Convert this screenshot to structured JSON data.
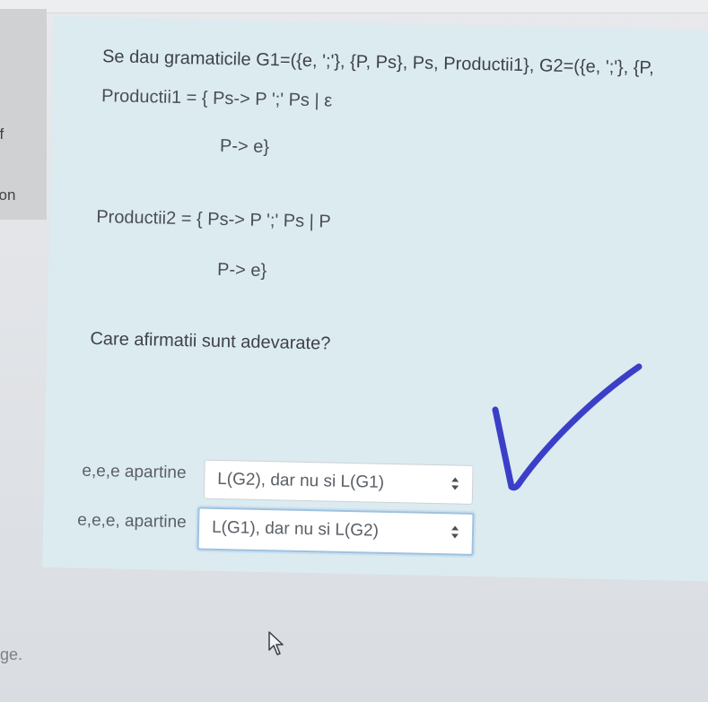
{
  "nav": {
    "items": [
      {
        "label": "of"
      },
      {
        "label": "tion"
      }
    ],
    "bottom_label": "ge."
  },
  "question": {
    "intro": "Se dau gramaticile G1=({e, ';'}, {P, Ps}, Ps, Productii1}, G2=({e, ';'}, {P,",
    "productii1_line1": "Productii1 = { Ps-> P ';' Ps | ε",
    "productii1_line2": "P-> e}",
    "productii2_line1": "Productii2 = { Ps-> P ';' Ps | P",
    "productii2_line2": "P-> e}",
    "prompt": "Care afirmatii sunt adevarate?"
  },
  "answers": [
    {
      "label": "e,e,e apartine",
      "selected": "L(G2), dar nu si L(G1)"
    },
    {
      "label": "e,e,e, apartine",
      "selected": "L(G1), dar nu si L(G2)"
    }
  ],
  "colors": {
    "card": "#dcebf0",
    "checkmark": "#3b3fc8",
    "focus_ring": "#9fc2de"
  },
  "icons": {
    "select_arrows": "updown-arrows-icon",
    "annotation": "checkmark-icon",
    "pointer": "mouse-cursor-icon"
  }
}
